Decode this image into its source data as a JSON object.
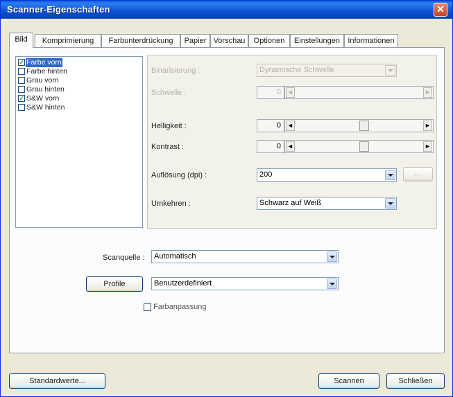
{
  "window": {
    "title": "Scanner-Eigenschaften",
    "close_glyph": "✕"
  },
  "tabs": [
    {
      "label": "Bild"
    },
    {
      "label": "Komprimierung"
    },
    {
      "label": "Farbunterdrückung"
    },
    {
      "label": "Papier"
    },
    {
      "label": "Vorschau"
    },
    {
      "label": "Optionen"
    },
    {
      "label": "Einstellungen"
    },
    {
      "label": "Informationen"
    }
  ],
  "image_list": [
    {
      "label": "Farbe vorn",
      "checked": true,
      "selected": true
    },
    {
      "label": "Farbe hinten",
      "checked": false
    },
    {
      "label": "Grau vorn",
      "checked": false
    },
    {
      "label": "Grau hinten",
      "checked": false
    },
    {
      "label": "S&W vorn",
      "checked": true
    },
    {
      "label": "S&W hinten",
      "checked": false
    }
  ],
  "check_glyph": "✓",
  "settings": {
    "binarization": {
      "label": "Binarisierung :",
      "value": "Dynamische Schwelle"
    },
    "threshold": {
      "label": "Schwelle :",
      "value": "0"
    },
    "brightness": {
      "label": "Helligkeit :",
      "value": "0"
    },
    "contrast": {
      "label": "Kontrast :",
      "value": "0"
    },
    "resolution": {
      "label": "Auflösung (dpi) :",
      "value": "200",
      "button": "..."
    },
    "invert": {
      "label": "Umkehren :",
      "value": "Schwarz auf Weiß"
    }
  },
  "slider_arrows": {
    "left": "◄",
    "right": "►"
  },
  "scan_source": {
    "label": "Scanquelle :",
    "value": "Automatisch"
  },
  "profile": {
    "button": "Profile",
    "value": "Benutzerdefiniert"
  },
  "color_matching": {
    "label": "Farbanpassung",
    "checked": false
  },
  "footer": {
    "defaults": "Standardwerte...",
    "scan": "Scannen",
    "close": "Schließen"
  }
}
